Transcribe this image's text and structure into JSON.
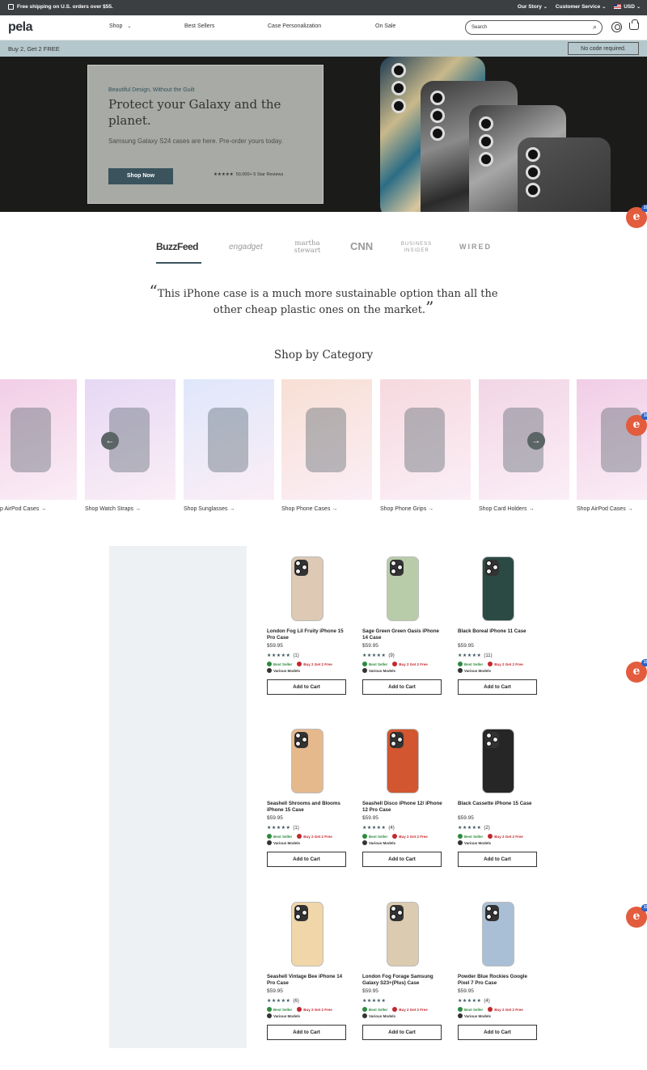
{
  "topbar": {
    "shipping": "Free shipping on U.S. orders over $55.",
    "our_story": "Our Story",
    "customer_service": "Customer Service",
    "currency": "USD"
  },
  "nav": {
    "logo": "pela",
    "items": [
      "Shop",
      "Best Sellers",
      "Case Personalization",
      "On Sale"
    ],
    "search_placeholder": "Search"
  },
  "promo": {
    "text": "Buy 2, Get 2 FREE",
    "code": "No code required."
  },
  "hero": {
    "eyebrow": "Beautiful Design, Without the Guilt",
    "title": "Protect your Galaxy and the planet.",
    "subtitle": "Samsung Galaxy S24 cases are here. Pre-order yours today.",
    "button": "Shop Now",
    "stars": "★★★★★",
    "reviews": "50,000+ 5 Star Reviews"
  },
  "press": [
    "BuzzFeed",
    "engadget",
    "martha stewart",
    "CNN",
    "BUSINESS INSIDER",
    "WIRED"
  ],
  "quote": "This iPhone case is a much more sustainable option than all the other cheap plastic ones on the market.",
  "category_title": "Shop by Category",
  "categories": [
    {
      "label": "p AirPod Cases",
      "bg": "#f1cde6"
    },
    {
      "label": "Shop Watch Straps",
      "bg": "#e6d8f4"
    },
    {
      "label": "Shop Sunglasses",
      "bg": "#dfe7fb"
    },
    {
      "label": "Shop Phone Cases",
      "bg": "#f8dfd4"
    },
    {
      "label": "Shop Phone Grips",
      "bg": "#f6d9df"
    },
    {
      "label": "Shop Card Holders",
      "bg": "#f2d6e6"
    },
    {
      "label": "Shop AirPod Cases",
      "bg": "#f1cde6"
    }
  ],
  "badge": {
    "letter": "e",
    "count": "19"
  },
  "products": [
    {
      "title": "London Fog Lil Fruity iPhone 15 Pro Case",
      "price": "$59.95",
      "stars": "★★★★★",
      "count": "(1)",
      "best": "Best Seller",
      "buy": "Buy 2 Get 2 Free",
      "models": "Various Models",
      "cta": "Add to Cart",
      "color": "#ddc9b4"
    },
    {
      "title": "Sage Green Green Oasis iPhone 14 Case",
      "price": "$59.95",
      "stars": "★★★★★",
      "count": "(9)",
      "best": "Best Seller",
      "buy": "Buy 2 Get 2 Free",
      "models": "Various Models",
      "cta": "Add to Cart",
      "color": "#b9cca9"
    },
    {
      "title": "Black Boreal iPhone 11 Case",
      "price": "$59.95",
      "stars": "★★★★★",
      "count": "(11)",
      "best": "Best Seller",
      "buy": "Buy 2 Get 2 Free",
      "models": "Various Models",
      "cta": "Add to Cart",
      "color": "#2b4a44"
    },
    {
      "title": "Seashell Shrooms and Blooms iPhone 15 Case",
      "price": "$59.95",
      "stars": "★★★★★",
      "count": "(1)",
      "best": "Best Seller",
      "buy": "Buy 2 Get 2 Free",
      "models": "Various Models",
      "cta": "Add to Cart",
      "color": "#e6b98d"
    },
    {
      "title": "Seashell Disco iPhone 12/ iPhone 12 Pro Case",
      "price": "$59.95",
      "stars": "★★★★★",
      "count": "(4)",
      "best": "Best Seller",
      "buy": "Buy 2 Get 2 Free",
      "models": "Various Models",
      "cta": "Add to Cart",
      "color": "#d2562f"
    },
    {
      "title": "Black Cassette iPhone 15 Case",
      "price": "$59.95",
      "stars": "★★★★★",
      "count": "(2)",
      "best": "Best Seller",
      "buy": "Buy 2 Get 2 Free",
      "models": "Various Models",
      "cta": "Add to Cart",
      "color": "#262626"
    },
    {
      "title": "Seashell Vintage Bee iPhone 14 Pro Case",
      "price": "$59.95",
      "stars": "★★★★★",
      "count": "(6)",
      "best": "Best Seller",
      "buy": "Buy 2 Get 2 Free",
      "models": "Various Models",
      "cta": "Add to Cart",
      "color": "#f0d6a8"
    },
    {
      "title": "London Fog Forage Samsung Galaxy S23+(Plus) Case",
      "price": "$59.95",
      "stars": "★★★★★",
      "count": "",
      "best": "Best Seller",
      "buy": "Buy 2 Get 2 Free",
      "models": "Various Models",
      "cta": "Add to Cart",
      "color": "#dbcbb0"
    },
    {
      "title": "Powder Blue Rockies Google Pixel 7 Pro Case",
      "price": "$59.95",
      "stars": "★★★★★",
      "count": "(4)",
      "best": "Best Seller",
      "buy": "Buy 2 Get 2 Free",
      "models": "Various Models",
      "cta": "Add to Cart",
      "color": "#a9bfd6"
    }
  ]
}
